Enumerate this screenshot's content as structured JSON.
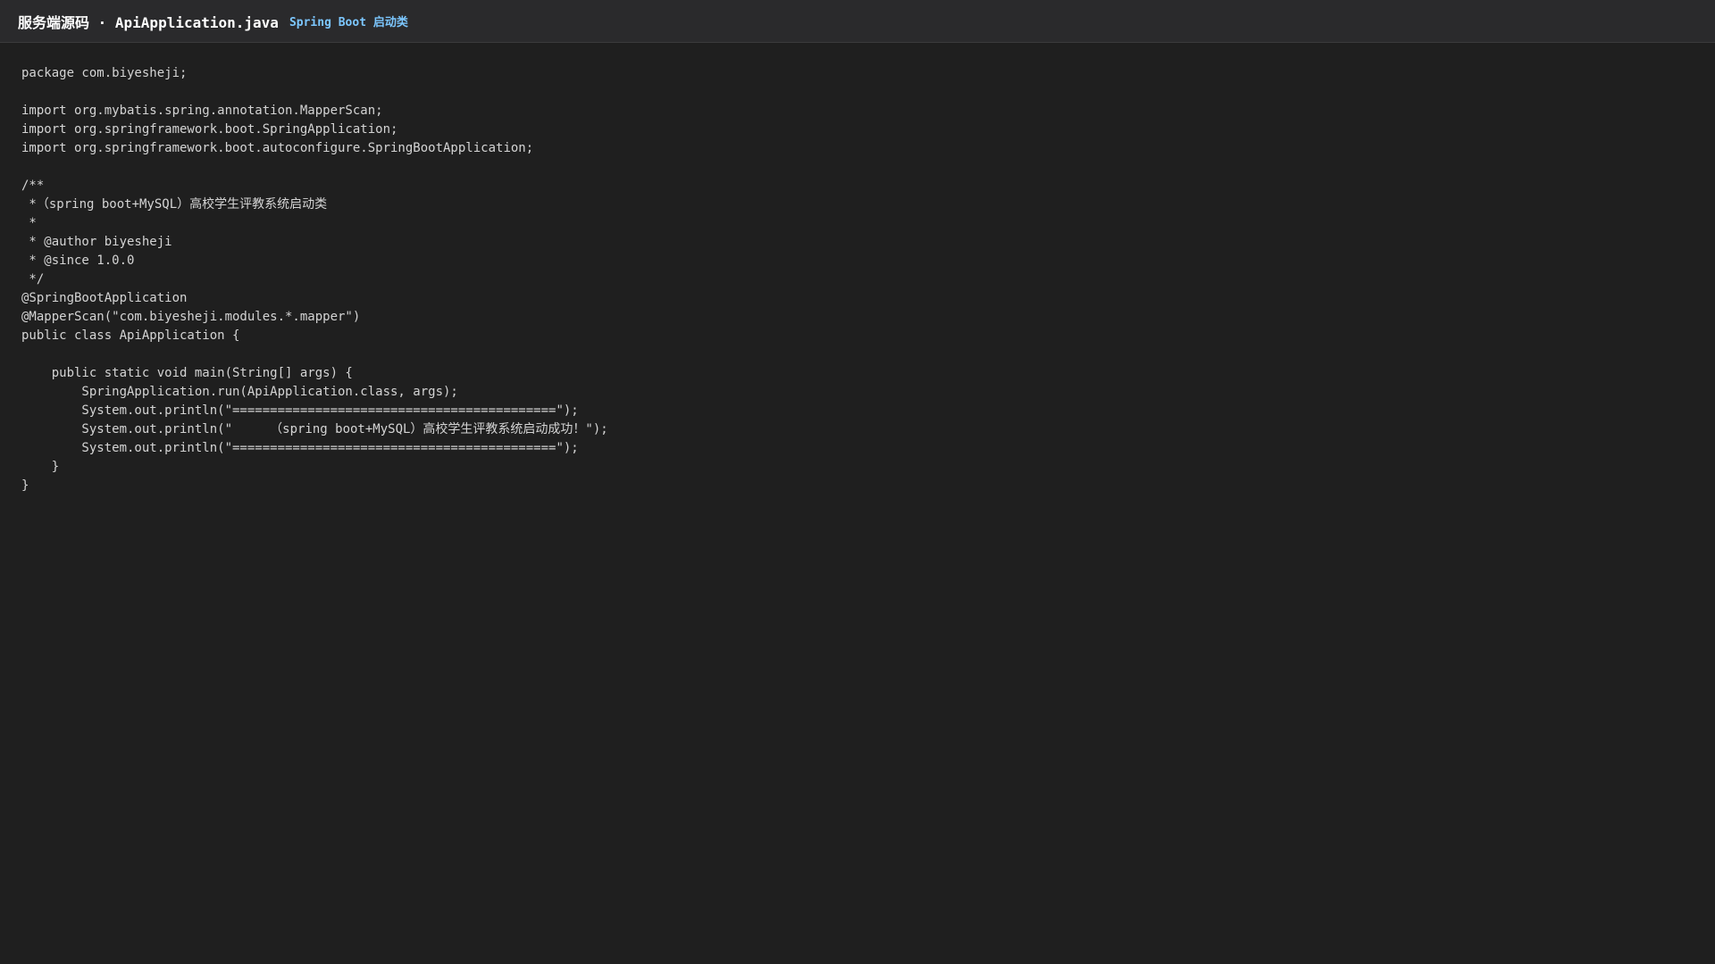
{
  "header": {
    "title": "服务端源码 · ApiApplication.java",
    "subtitle": "Spring Boot 启动类"
  },
  "code_lines": [
    "package com.biyesheji;",
    "",
    "import org.mybatis.spring.annotation.MapperScan;",
    "import org.springframework.boot.SpringApplication;",
    "import org.springframework.boot.autoconfigure.SpringBootApplication;",
    "",
    "/**",
    " *（spring boot+MySQL）高校学生评教系统启动类",
    " *",
    " * @author biyesheji",
    " * @since 1.0.0",
    " */",
    "@SpringBootApplication",
    "@MapperScan(\"com.biyesheji.modules.*.mapper\")",
    "public class ApiApplication {",
    "",
    "    public static void main(String[] args) {",
    "        SpringApplication.run(ApiApplication.class, args);",
    "        System.out.println(\"===========================================\");",
    "        System.out.println(\"     （spring boot+MySQL）高校学生评教系统启动成功！\");",
    "        System.out.println(\"===========================================\");",
    "    }",
    "}"
  ]
}
